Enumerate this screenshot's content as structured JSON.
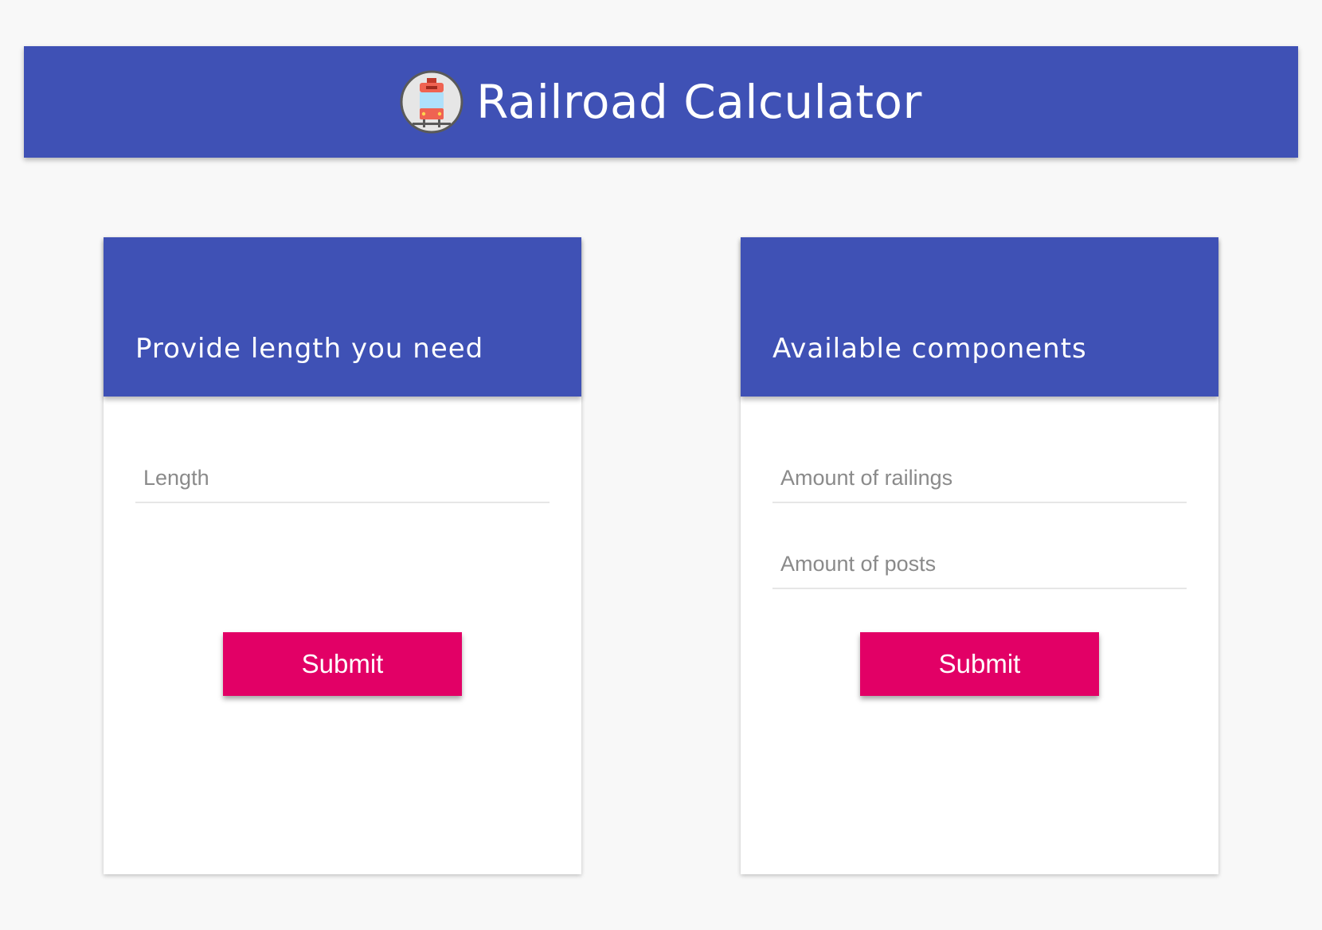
{
  "header": {
    "title": "Railroad Calculator",
    "logo_icon": "train-icon"
  },
  "length_card": {
    "title": "Provide length you need",
    "length_placeholder": "Length",
    "length_value": "",
    "submit_label": "Submit"
  },
  "components_card": {
    "title": "Available components",
    "railings_placeholder": "Amount of railings",
    "railings_value": "",
    "posts_placeholder": "Amount of posts",
    "posts_value": "",
    "submit_label": "Submit"
  },
  "colors": {
    "primary": "#3f51b5",
    "accent": "#e20066",
    "background": "#f8f8f8"
  }
}
